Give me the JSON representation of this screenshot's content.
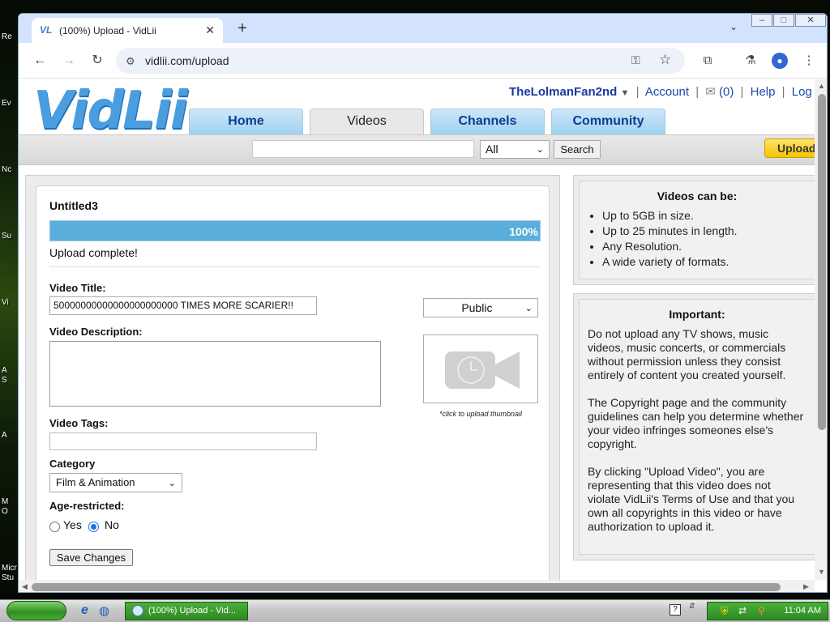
{
  "desktop": {
    "labels": [
      "Re",
      "Ev",
      "Nc",
      "Su",
      "Vi",
      "A",
      "S",
      "A",
      "M",
      "O",
      "Micr",
      "Stu"
    ]
  },
  "browser": {
    "tab_title": "(100%) Upload - VidLii",
    "url": "vidlii.com/upload"
  },
  "site": {
    "logo": "VidLii",
    "user": {
      "username": "TheLolmanFan2nd",
      "account": "Account",
      "inbox_count": "(0)",
      "help": "Help",
      "logout": "Log C"
    },
    "nav_tabs": [
      {
        "label": "Home",
        "active": false
      },
      {
        "label": "Videos",
        "active": true
      },
      {
        "label": "Channels",
        "active": false
      },
      {
        "label": "Community",
        "active": false
      }
    ],
    "search": {
      "query": "",
      "scope": "All",
      "button": "Search"
    },
    "upload_button": "Upload"
  },
  "upload": {
    "file_name": "Untitled3",
    "progress_percent": 100,
    "progress_label": "100%",
    "status": "Upload complete!",
    "video_title_label": "Video Title:",
    "video_title_value": "50000000000000000000000 TIMES MORE SCARIER!!",
    "privacy": "Public",
    "video_description_label": "Video Description:",
    "video_description_value": "",
    "thumbnail_caption": "*click to upload thumbnail",
    "video_tags_label": "Video Tags:",
    "video_tags_value": "",
    "category_label": "Category",
    "category": "Film & Animation",
    "age_restricted_label": "Age-restricted:",
    "age_yes": "Yes",
    "age_no": "No",
    "age_selected": "No",
    "save_button": "Save Changes"
  },
  "sidebar": {
    "limits_title": "Videos can be:",
    "limits": [
      "Up to 5GB in size.",
      "Up to 25 minutes in length.",
      "Any Resolution.",
      "A wide variety of formats."
    ],
    "important_title": "Important:",
    "important_paragraphs": [
      "Do not upload any TV shows, music videos, music concerts, or commercials without permission unless they consist entirely of content you created yourself.",
      "The Copyright page and the community guidelines can help you determine whether your video infringes someones else's copyright.",
      "By clicking \"Upload Video\", you are representing that this video does not violate VidLii's Terms of Use and that you own all copyrights in this video or have authorization to upload it."
    ]
  },
  "taskbar": {
    "task_label": "(100%) Upload - Vid...",
    "clock": "11:04 AM"
  },
  "colors": {
    "accent_blue": "#5aaedb",
    "nav_text": "#0b3d91",
    "upload_yellow": "#f5c400",
    "taskbar_green": "#2c8a22"
  }
}
